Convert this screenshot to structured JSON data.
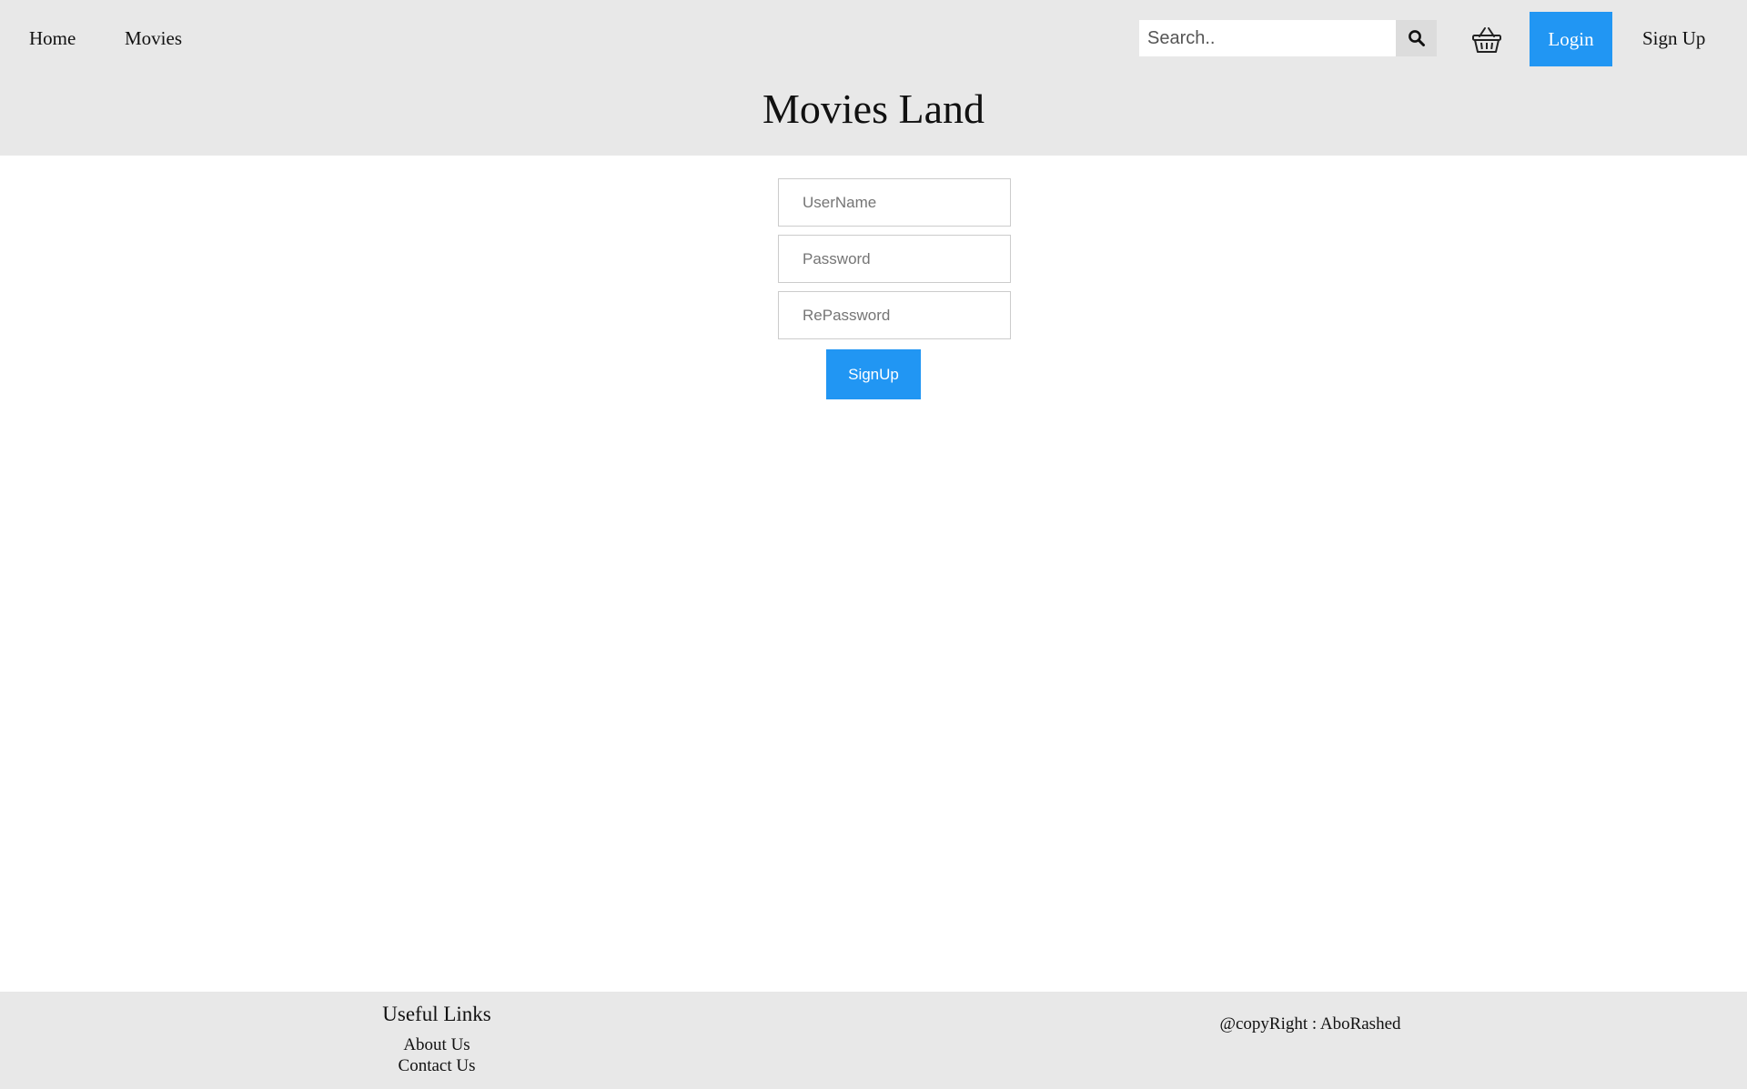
{
  "nav": {
    "home": "Home",
    "movies": "Movies",
    "search_placeholder": "Search..",
    "search_icon": "search-icon",
    "cart_icon": "basket-icon",
    "login": "Login",
    "signup": "Sign Up"
  },
  "site_title": "Movies Land",
  "form": {
    "username_placeholder": "UserName",
    "password_placeholder": "Password",
    "repassword_placeholder": "RePassword",
    "submit": "SignUp"
  },
  "footer": {
    "heading": "Useful Links",
    "links": [
      "About Us",
      "Contact Us"
    ],
    "copyright": "@copyRight : AboRashed"
  },
  "colors": {
    "accent": "#2196f3",
    "header_bg": "#e8e8e8",
    "footer_bg": "#e8e8e8"
  }
}
